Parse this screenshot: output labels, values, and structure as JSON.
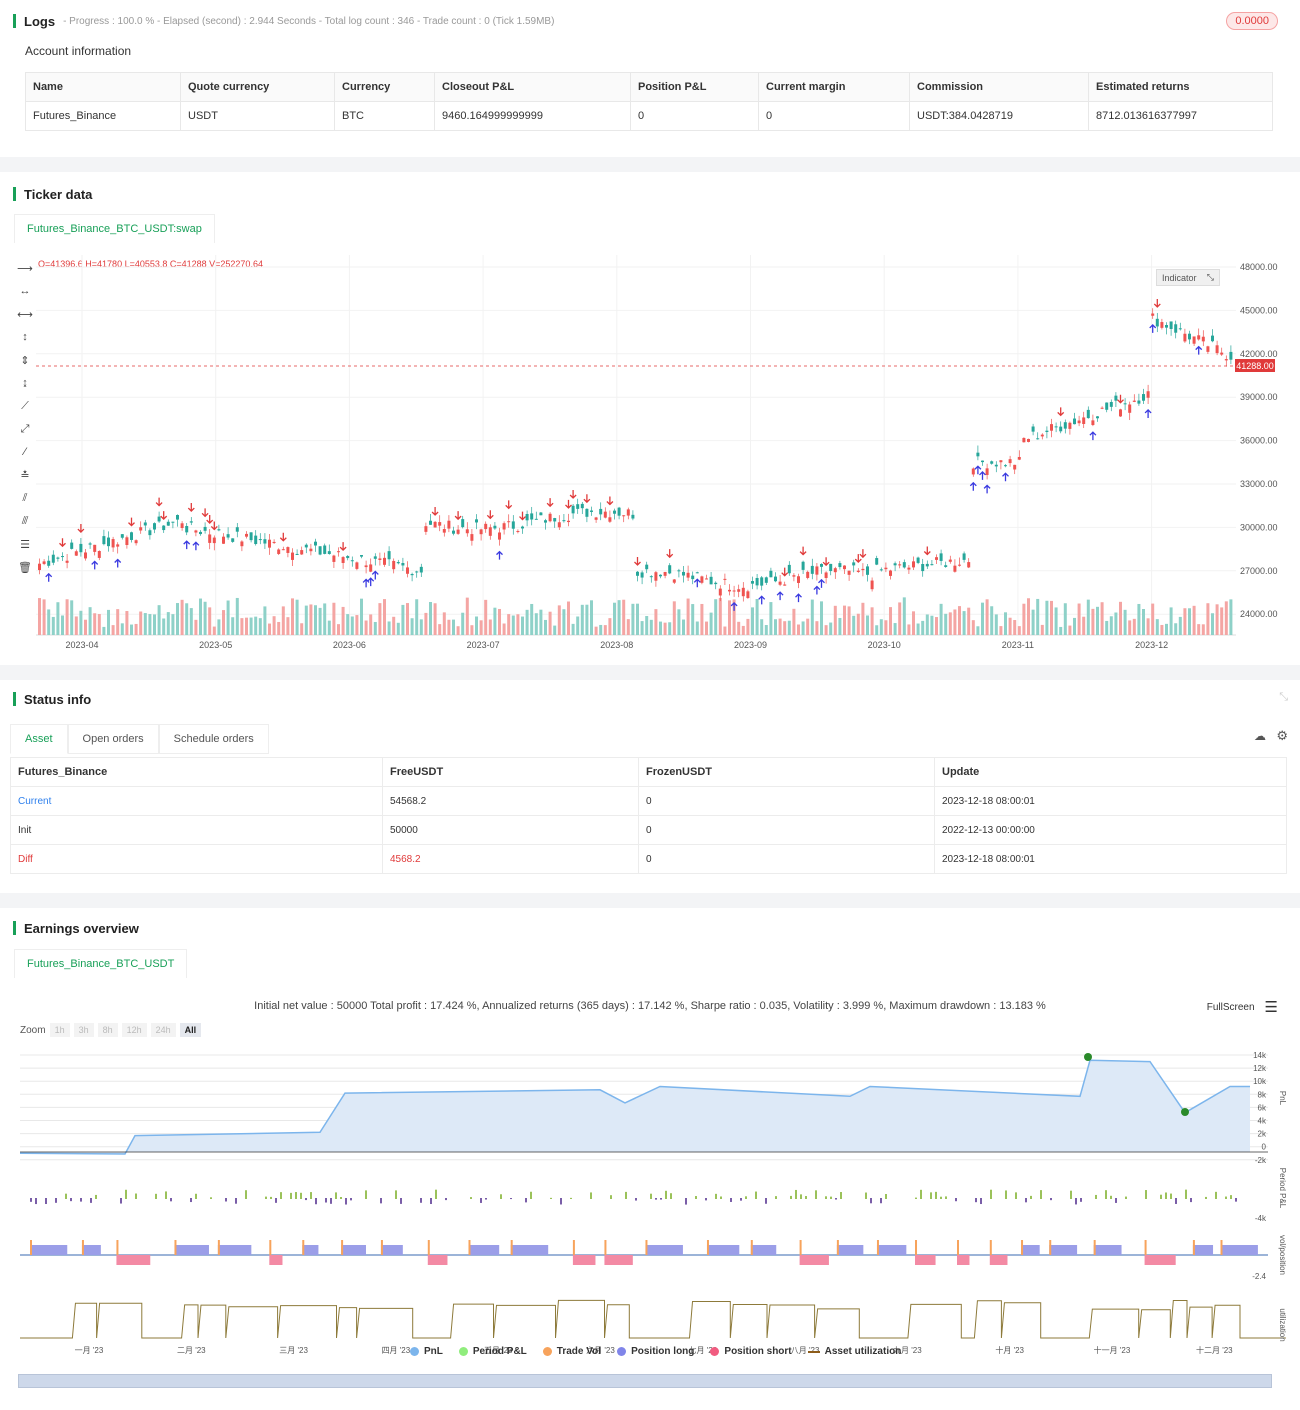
{
  "logs": {
    "title": "Logs",
    "meta": "- Progress : 100.0 % - Elapsed (second) : 2.944  Seconds - Total log count : 346 - Trade count : 0 (Tick 1.59MB)",
    "badge": "0.0000"
  },
  "account": {
    "title": "Account information",
    "headers": [
      "Name",
      "Quote currency",
      "Currency",
      "Closeout P&L",
      "Position P&L",
      "Current margin",
      "Commission",
      "Estimated returns"
    ],
    "row": [
      "Futures_Binance",
      "USDT",
      "BTC",
      "9460.164999999999",
      "0",
      "0",
      "USDT:384.0428719",
      "8712.013616377997"
    ]
  },
  "ticker": {
    "title": "Ticker data",
    "tab": "Futures_Binance_BTC_USDT:swap",
    "ohlc": "O=41396.6 H=41780 L=40553.8 C=41288 V=252270.64",
    "indicator_label": "Indicator",
    "last_price": "41288.00",
    "y_ticks": [
      "48000.00",
      "45000.00",
      "42000.00",
      "39000.00",
      "36000.00",
      "33000.00",
      "30000.00",
      "27000.00",
      "24000.00"
    ],
    "x_ticks": [
      "2023-04",
      "2023-05",
      "2023-06",
      "2023-07",
      "2023-08",
      "2023-09",
      "2023-10",
      "2023-11",
      "2023-12"
    ]
  },
  "status": {
    "title": "Status info",
    "tabs": [
      "Asset",
      "Open orders",
      "Schedule orders"
    ],
    "headers": [
      "Futures_Binance",
      "FreeUSDT",
      "FrozenUSDT",
      "Update"
    ],
    "rows": [
      [
        "Current",
        "54568.2",
        "0",
        "2023-12-18 08:00:01"
      ],
      [
        "Init",
        "50000",
        "0",
        "2022-12-13 00:00:00"
      ],
      [
        "Diff",
        "4568.2",
        "0",
        "2023-12-18 08:00:01"
      ]
    ]
  },
  "earnings": {
    "title": "Earnings overview",
    "tab": "Futures_Binance_BTC_USDT",
    "summary": "Initial net value : 50000 Total profit : 17.424 %, Annualized returns (365 days) : 17.142 %, Sharpe ratio : 0.035, Volatility : 3.999 %, Maximum drawdown : 13.183 %",
    "zoom_label": "Zoom",
    "zoom_buttons": [
      "1h",
      "3h",
      "8h",
      "12h",
      "24h",
      "All"
    ],
    "fullscreen": "FullScreen",
    "pnl_ticks": [
      "14k",
      "12k",
      "10k",
      "8k",
      "6k",
      "4k",
      "2k",
      "0",
      "-2k"
    ],
    "period_ticks": [
      "-4k"
    ],
    "vol_ticks": [
      "-2.4"
    ],
    "axis_names": [
      "PnL",
      "Period P&L",
      "vol/position",
      "utilization"
    ],
    "x_ticks": [
      "一月 '23",
      "二月 '23",
      "三月 '23",
      "四月 '23",
      "五月 '23",
      "六月 '23",
      "七月 '23",
      "八月 '23",
      "九月 '23",
      "十月 '23",
      "十一月 '23",
      "十二月 '23"
    ],
    "legend": [
      {
        "label": "PnL",
        "color": "#7cb5ec"
      },
      {
        "label": "Period P&L",
        "color": "#90ed7d"
      },
      {
        "label": "Trade Vol",
        "color": "#f7a35c"
      },
      {
        "label": "Position long",
        "color": "#8085e9"
      },
      {
        "label": "Position short",
        "color": "#f15c80"
      },
      {
        "label": "Asset utilization",
        "color": "#8d8d5c"
      }
    ]
  }
}
